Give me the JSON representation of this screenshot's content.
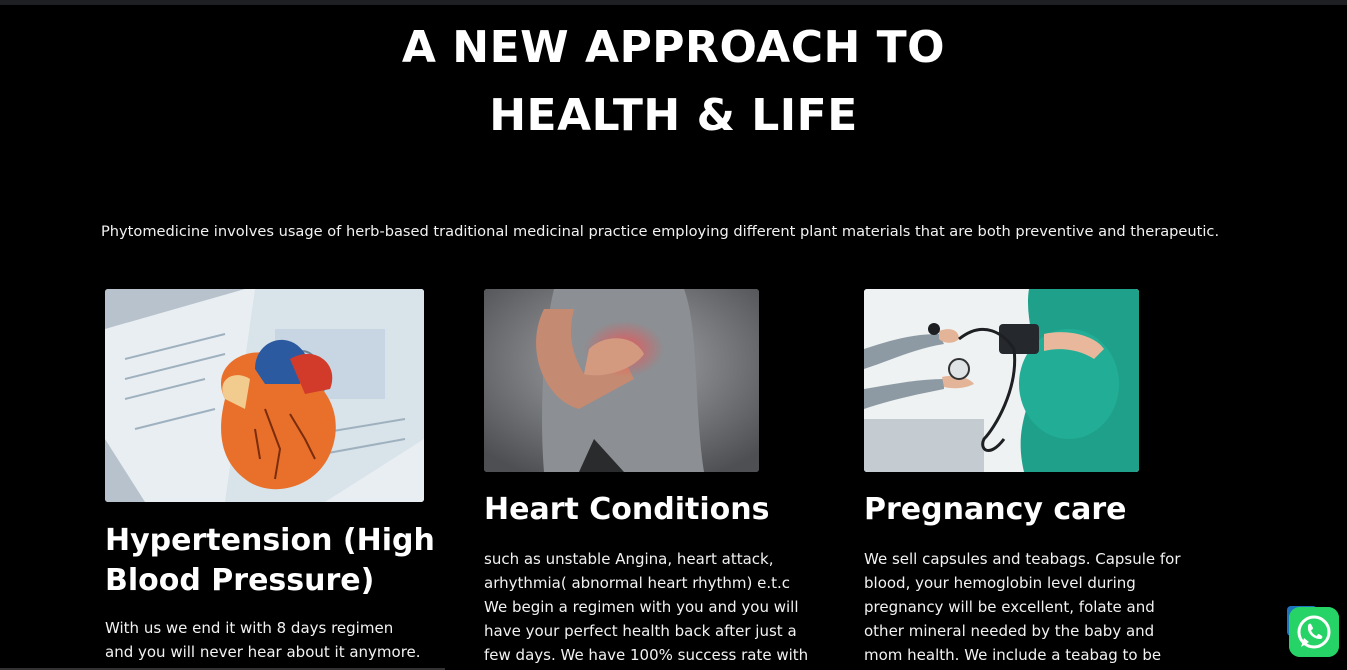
{
  "hero": {
    "title_line1": "A NEW APPROACH TO",
    "title_line2": "HEALTH & LIFE"
  },
  "intro": "Phytomedicine involves usage of herb-based traditional medicinal practice employing different plant materials that are both preventive and therapeutic.",
  "cards": [
    {
      "title": "Hypertension (High Blood Pressure)",
      "text": "With us we end it with 8 days regimen and you will never hear about it anymore.",
      "image": "anatomical-heart-model-on-textbook"
    },
    {
      "title": "Heart Conditions",
      "text": "such as unstable Angina, heart attack, arhythmia( abnormal heart rhythm) e.t.c We begin a regimen with you and you will have your perfect health back after just a few days. We have 100% success rate with",
      "image": "man-holding-chest-in-pain"
    },
    {
      "title": "Pregnancy care",
      "text": "We sell capsules and teabags. Capsule for blood, your hemoglobin level during pregnancy will be excellent, folate and other mineral needed by the baby and mom health. We include a teabag to be",
      "image": "pregnant-woman-blood-pressure-check"
    }
  ],
  "widgets": {
    "whatsapp_icon": "whatsapp-icon",
    "scroll_top_icon": "scroll-to-top-icon",
    "accent_color": "#25d366",
    "scroll_color": "#1e73be"
  }
}
